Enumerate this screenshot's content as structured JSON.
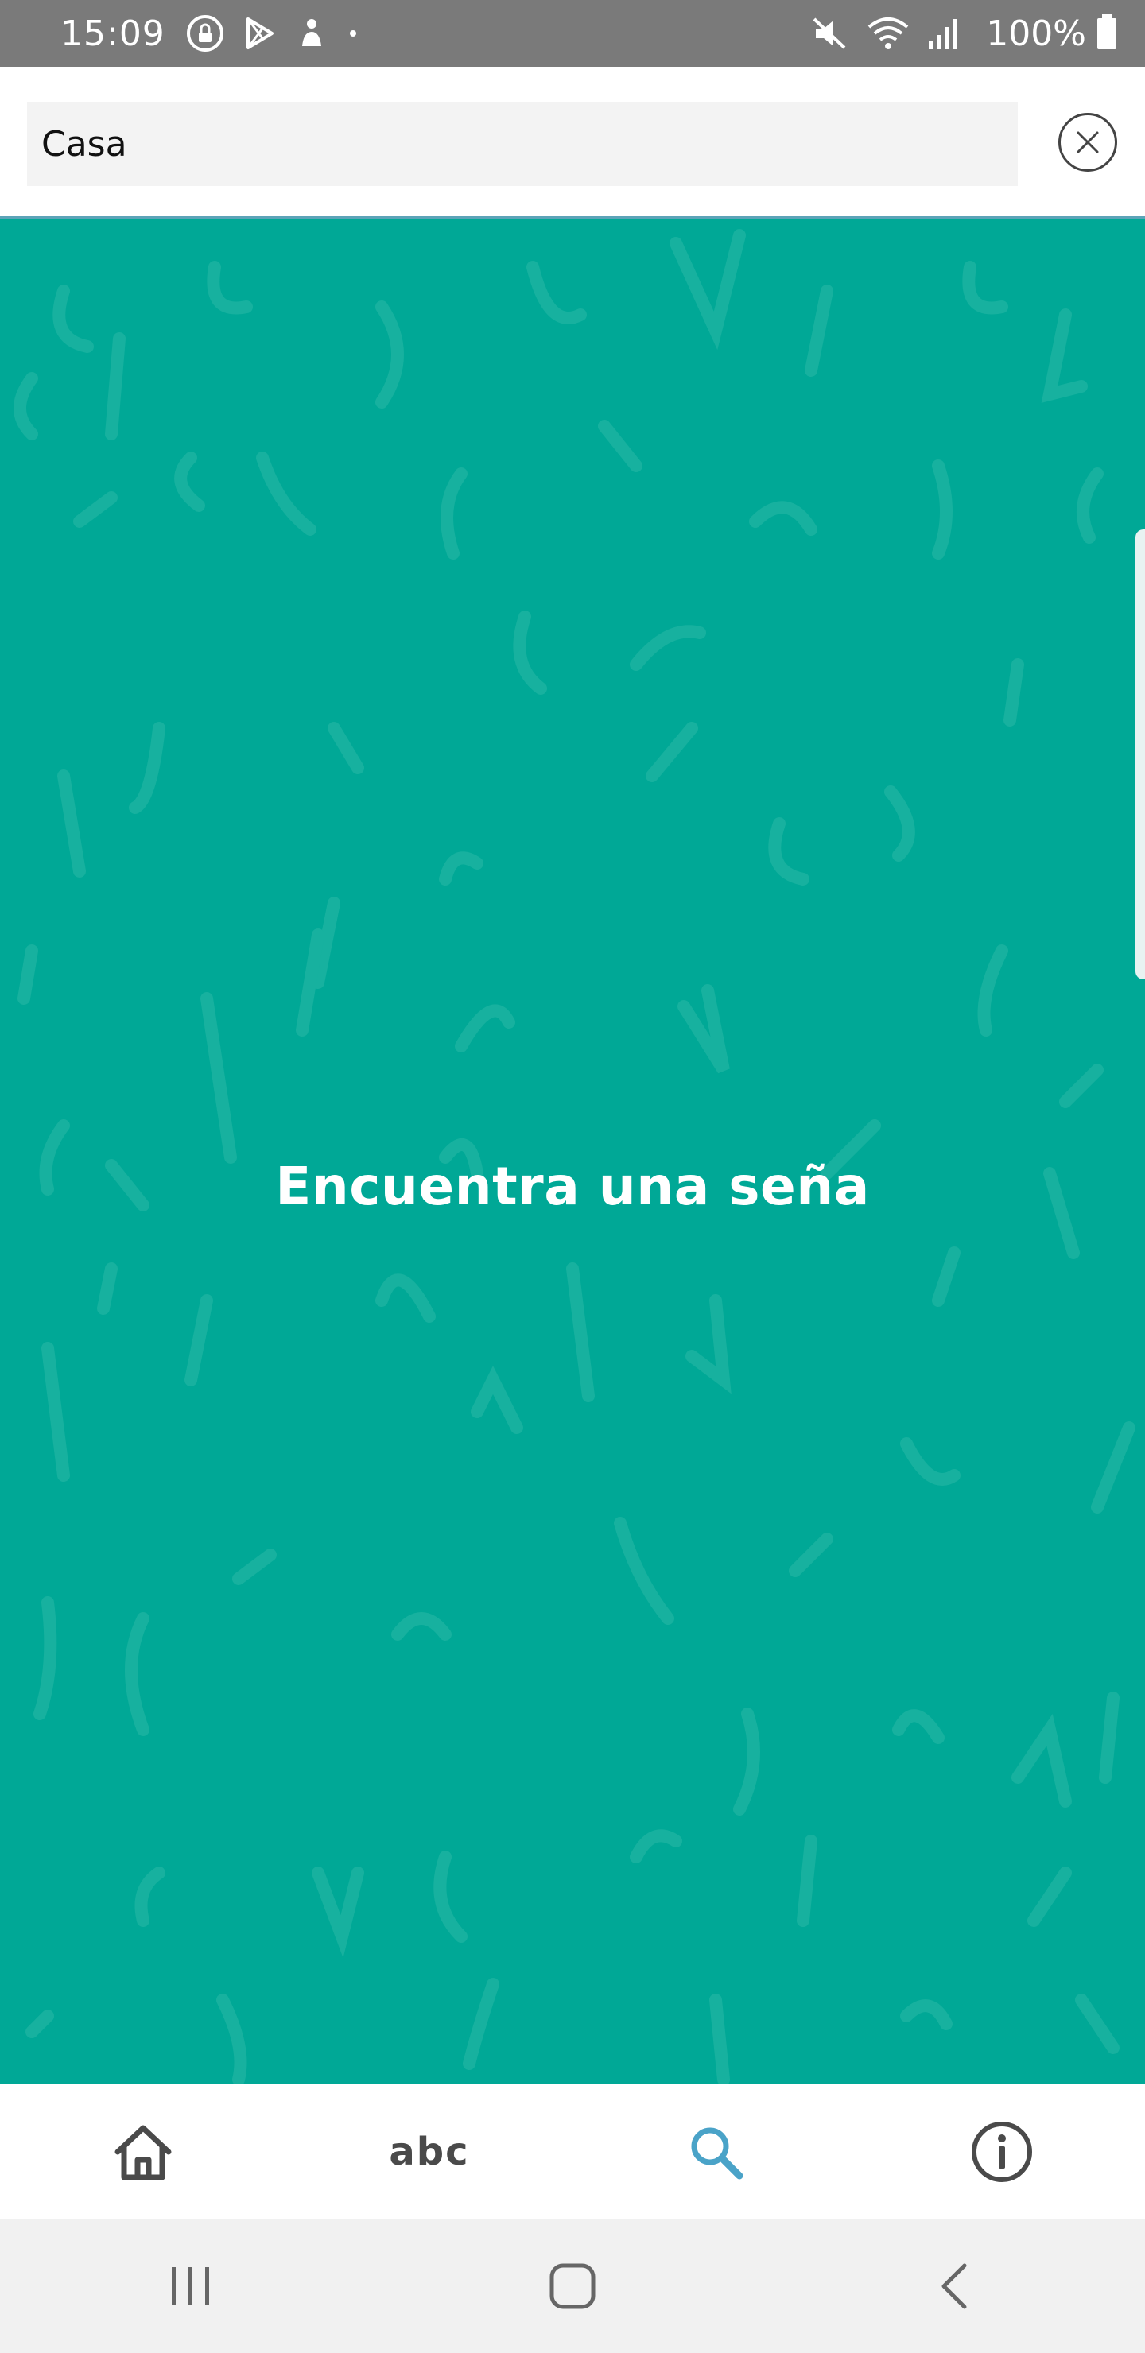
{
  "status_bar": {
    "time": "15:09",
    "battery": "100%"
  },
  "search": {
    "value": "Casa",
    "placeholder": ""
  },
  "main": {
    "message": "Encuentra una seña"
  },
  "bottom_nav": {
    "items": [
      {
        "icon": "home-icon",
        "active": false
      },
      {
        "icon": "abc-icon",
        "active": false
      },
      {
        "icon": "search-icon",
        "active": true
      },
      {
        "icon": "info-icon",
        "active": false
      }
    ],
    "abc_label": "abc"
  },
  "colors": {
    "status_bar": "#7a7a7a",
    "teal": "#00a896",
    "accent": "#4aa3c8",
    "icon": "#4a4a4a"
  }
}
